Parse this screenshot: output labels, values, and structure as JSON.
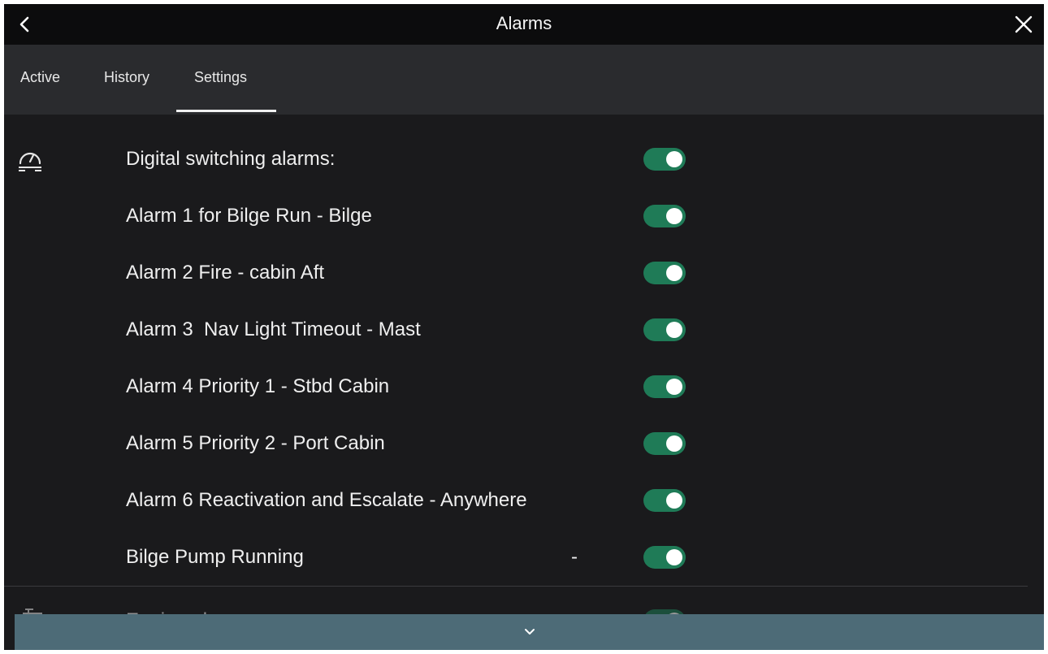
{
  "window": {
    "title": "Alarms"
  },
  "tabs": [
    {
      "label": "Active"
    },
    {
      "label": "History"
    },
    {
      "label": "Settings",
      "selected": true
    }
  ],
  "sections": {
    "digital_switching": {
      "icon": "gauge-icon",
      "rows": [
        {
          "label": "Digital switching alarms:",
          "enabled": true
        },
        {
          "label": "Alarm 1 for Bilge Run - Bilge",
          "enabled": true
        },
        {
          "label": "Alarm 2 Fire - cabin Aft",
          "enabled": true
        },
        {
          "label": "Alarm 3  Nav Light Timeout - Mast",
          "enabled": true
        },
        {
          "label": "Alarm 4 Priority 1 - Stbd Cabin",
          "enabled": true
        },
        {
          "label": "Alarm 5 Priority 2 - Port Cabin",
          "enabled": true
        },
        {
          "label": "Alarm 6 Reactivation and Escalate - Anywhere",
          "enabled": true
        },
        {
          "label": "Bilge Pump Running",
          "suffix": "-",
          "enabled": true
        }
      ]
    },
    "engine": {
      "icon": "engine-icon",
      "label": "Engine alarms:",
      "enabled": true
    }
  },
  "colors": {
    "toggle_on": "#1f7b57",
    "scroll_bar": "#4d6b77"
  }
}
